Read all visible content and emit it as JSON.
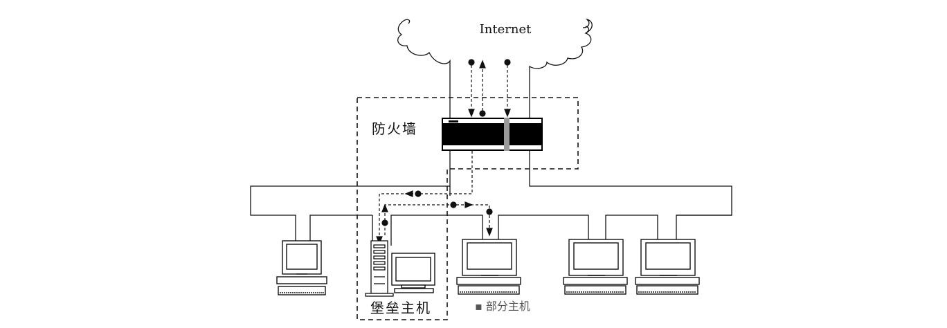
{
  "labels": {
    "internet": "Internet",
    "firewall": "防火墙",
    "bastion_host": "堡垒主机",
    "faint_caption": "▪ 部分主机"
  },
  "colors": {
    "line": "#111111",
    "dashed": "#111111",
    "firewall_body": "#000000",
    "firewall_stripe": "#9a9a9a",
    "monitor_fill": "#ffffff"
  },
  "icons": {
    "cloud": "internet-cloud-icon",
    "firewall": "firewall-device-icon",
    "workstation": "workstation-icon",
    "server": "server-tower-icon"
  }
}
